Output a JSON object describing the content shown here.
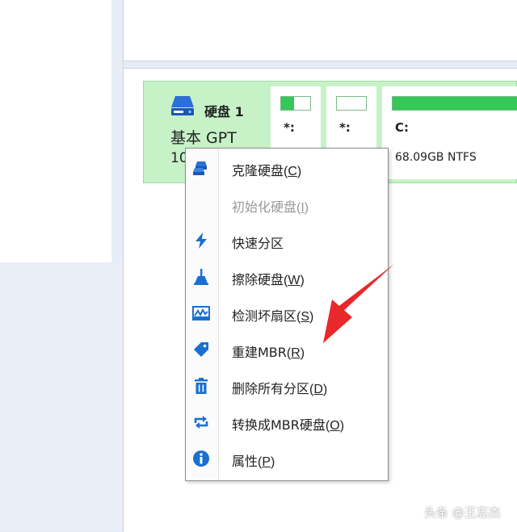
{
  "disk": {
    "name": "硬盘 1",
    "type": "基本 GPT",
    "size_partial": "10"
  },
  "partitions": [
    {
      "label": "*:",
      "detail": "",
      "fill_fraction": 0.45
    },
    {
      "label": "*:",
      "detail": "",
      "fill_fraction": 0.0
    },
    {
      "label": "C:",
      "detail": "68.09GB NTFS",
      "fill_fraction": 1.0
    }
  ],
  "context_menu": {
    "items": [
      {
        "label": "克隆硬盘",
        "key": "C",
        "icon": "clone-disk-icon",
        "enabled": true
      },
      {
        "label": "初始化硬盘",
        "key": "I",
        "icon": "",
        "enabled": false
      },
      {
        "label": "快速分区",
        "key": "",
        "icon": "lightning-icon",
        "enabled": true
      },
      {
        "label": "擦除硬盘",
        "key": "W",
        "icon": "broom-icon",
        "enabled": true
      },
      {
        "label": "检测坏扇区",
        "key": "S",
        "icon": "bad-sector-icon",
        "enabled": true
      },
      {
        "label": "重建MBR",
        "key": "R",
        "icon": "tag-icon",
        "enabled": true
      },
      {
        "label": "删除所有分区",
        "key": "D",
        "icon": "trash-icon",
        "enabled": true
      },
      {
        "label": "转换成MBR硬盘",
        "key": "O",
        "icon": "convert-icon",
        "enabled": true
      },
      {
        "label": "属性",
        "key": "P",
        "icon": "info-icon",
        "enabled": true
      }
    ]
  },
  "watermark": "头条 @王忘杰",
  "colors": {
    "accent": "#1a6fd1",
    "disk_row": "#c7f2c8",
    "partition_fill": "#35c758",
    "arrow": "#e8282a"
  }
}
